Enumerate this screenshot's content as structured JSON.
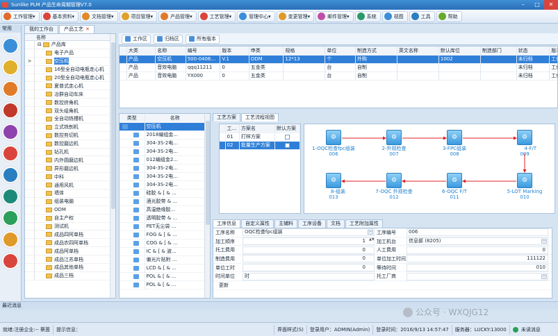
{
  "app": {
    "title": "Sunlike PLM 产品生命周期管理V7.0"
  },
  "menu": [
    {
      "label": "工作管理",
      "color": "#e06b2a"
    },
    {
      "label": "基本资料",
      "color": "#d9453c"
    },
    {
      "label": "文档管理",
      "color": "#e08a2a"
    },
    {
      "label": "项目管理",
      "color": "#e0a12a"
    },
    {
      "label": "产品管理",
      "color": "#e07b2a"
    },
    {
      "label": "工艺管理",
      "color": "#d9453c"
    },
    {
      "label": "管理中心",
      "color": "#3a8fd8"
    },
    {
      "label": "变更管理",
      "color": "#e09a2a"
    },
    {
      "label": "邮件管理",
      "color": "#c04fa8"
    },
    {
      "label": "系统",
      "color": "#2a9a6a"
    },
    {
      "label": "视图",
      "color": "#3a8fd8"
    },
    {
      "label": "工具",
      "color": "#2a7fc0"
    },
    {
      "label": "帮助",
      "color": "#6aaa2a"
    }
  ],
  "left_pane": {
    "header": "常用",
    "icons": [
      {
        "name": "hub-icon",
        "color": "#3a8fd8"
      },
      {
        "name": "monitor-icon",
        "color": "#e0b02a"
      },
      {
        "name": "building-icon",
        "color": "#e07b2a"
      },
      {
        "name": "settings-icon",
        "color": "#c0392b"
      },
      {
        "name": "gear-icon",
        "color": "#8e44ad"
      },
      {
        "name": "mail-icon",
        "color": "#d9453c"
      },
      {
        "name": "contact-icon",
        "color": "#2a7fc0"
      },
      {
        "name": "document-icon",
        "color": "#1e8a7a"
      },
      {
        "name": "network-icon",
        "color": "#2aa05a"
      },
      {
        "name": "package-icon",
        "color": "#e09a2a"
      },
      {
        "name": "book-icon",
        "color": "#d9453c"
      }
    ]
  },
  "tabs": [
    {
      "label": "我的工作台",
      "selected": false
    },
    {
      "label": "产品工艺",
      "selected": true,
      "close": "✕"
    }
  ],
  "tree": {
    "header": "名称",
    "root": "产品库",
    "items": [
      "电子产品",
      "空压机",
      "16型全自动电瓶走心机",
      "20型全自动电瓶走心机",
      "夏普式走心机",
      "冶群自动车床",
      "数控挤角机",
      "双头组角机",
      "全自动铣槽机",
      "立式铣刨机",
      "数控剪切机",
      "数控磨边机",
      "钻孔机",
      "内外圆磨边机",
      "异形磨边机",
      "中科",
      "通用风机",
      "墙体",
      "组装电脑",
      "ODM",
      "自主产权",
      "测试机",
      "成品四阿单档",
      "成品农四阿单档",
      "成品阿单档",
      "成品江苏单档",
      "成品其他单档",
      "成品三档"
    ],
    "selected_index": 1,
    "row_marker": ">"
  },
  "toolbar": {
    "buttons": [
      "工作区",
      "归档区",
      "所有版本"
    ]
  },
  "product_grid": {
    "columns": [
      "大类",
      "名称",
      "编号",
      "版本",
      "申类",
      "规格",
      "单位",
      "制造方式",
      "英文名称",
      "默认库位",
      "制造部门",
      "状态",
      "版本"
    ],
    "rows": [
      [
        "产品",
        "空压机",
        "500-0406...",
        "V.1",
        "ODM",
        "12*13",
        "个",
        "外购",
        "",
        "1002",
        "",
        "未归档",
        "工作"
      ],
      [
        "产品",
        "音效电脑",
        "qqq11211",
        "0",
        "五金类",
        "",
        "台",
        "自制",
        "",
        "",
        "",
        "未归档",
        "工作"
      ],
      [
        "产品",
        "音效电脑",
        "YX000",
        "0",
        "五金类",
        "",
        "台",
        "自制",
        "",
        "",
        "",
        "未归档",
        "工作"
      ]
    ],
    "selected_row": 0
  },
  "bom_grid": {
    "columns": [
      "类型",
      "名称"
    ],
    "rows": [
      "空压机",
      "2018编组金...",
      "304-3S-2电...",
      "304-3S-2电...",
      "012编组金2...",
      "304-3S-2电...",
      "304-3S-2电...",
      "304-3S-2电...",
      "硅胶 & [ & ...",
      "酒光胶带 & ...",
      "高温绝缘胶...",
      "透明胶带 & ...",
      "PET无尘袋 ...",
      "FOG & [ & ...",
      "COG & [ & ...",
      "IC & [ & 波...",
      "偏光片贴附 ...",
      "LCD & [ & ...",
      "POL & [ & ...",
      "POL & [ & ..."
    ],
    "selected_row": 0
  },
  "process_tabs": [
    {
      "label": "工艺方案",
      "selected": false
    },
    {
      "label": "工艺流程视图",
      "selected": true
    }
  ],
  "process_list": {
    "columns": [
      "工...",
      "方案名",
      "默认方案"
    ],
    "rows": [
      {
        "no": "01",
        "name": "打样方案"
      },
      {
        "no": "02",
        "name": "批量生产方案"
      }
    ],
    "selected_row": 1
  },
  "flow": {
    "top_row": [
      {
        "name": "1-OQC检查fpc组装",
        "code": "006"
      },
      {
        "name": "2-外观检查",
        "code": "007"
      },
      {
        "name": "3-FPC组装",
        "code": "008"
      },
      {
        "name": "4-F/T",
        "code": "009"
      }
    ],
    "bottom_row": [
      {
        "name": "8-组装",
        "code": "013"
      },
      {
        "name": "7-OQC 外观检查",
        "code": "012"
      },
      {
        "name": "6-OQC F/T",
        "code": "011"
      },
      {
        "name": "5-LOT Marking",
        "code": "010"
      }
    ],
    "arrow_color": "#e02020"
  },
  "detail_tabs": [
    {
      "label": "工序信息",
      "selected": true
    },
    {
      "label": "自定义属性",
      "selected": false
    },
    {
      "label": "主辅料",
      "selected": false
    },
    {
      "label": "工序设备",
      "selected": false
    },
    {
      "label": "文档",
      "selected": false
    },
    {
      "label": "工艺附加属性",
      "selected": false
    }
  ],
  "form": {
    "rows": [
      {
        "l1": "工序名称",
        "v1": "OQC检查fpc组装",
        "l2": "工序编号",
        "v2": "006"
      },
      {
        "l1": "加工顺序",
        "v1": "1",
        "l2": "加工机台",
        "v2": "信息部 (8205)"
      },
      {
        "l1": "托工费用",
        "v1": "0",
        "l2": "人工费用",
        "v2": "0"
      },
      {
        "l1": "制造费用",
        "v1": "0",
        "l2": "单位加工时间",
        "v2": "111122"
      },
      {
        "l1": "单位工时",
        "v1": "0",
        "l2": "等待时间",
        "v2": "010"
      },
      {
        "l1": "时间单位",
        "v1": "时",
        "l2": "托工厂商",
        "v2": ""
      }
    ],
    "update_label": "更新"
  },
  "status_top": "最近消息",
  "statusbar": {
    "company": "就绪:注册企业:-- 蔡茵",
    "hint": "提示信息：",
    "style": "界面样式(S)",
    "user": "登录用户：ADMIN(Admin)",
    "login_time": "登录时间：2016/9/13 14:57:47",
    "server": "服务器：LUCKY:13000",
    "messages": "未读消息"
  },
  "watermark": "公众号 · WXQJG12"
}
